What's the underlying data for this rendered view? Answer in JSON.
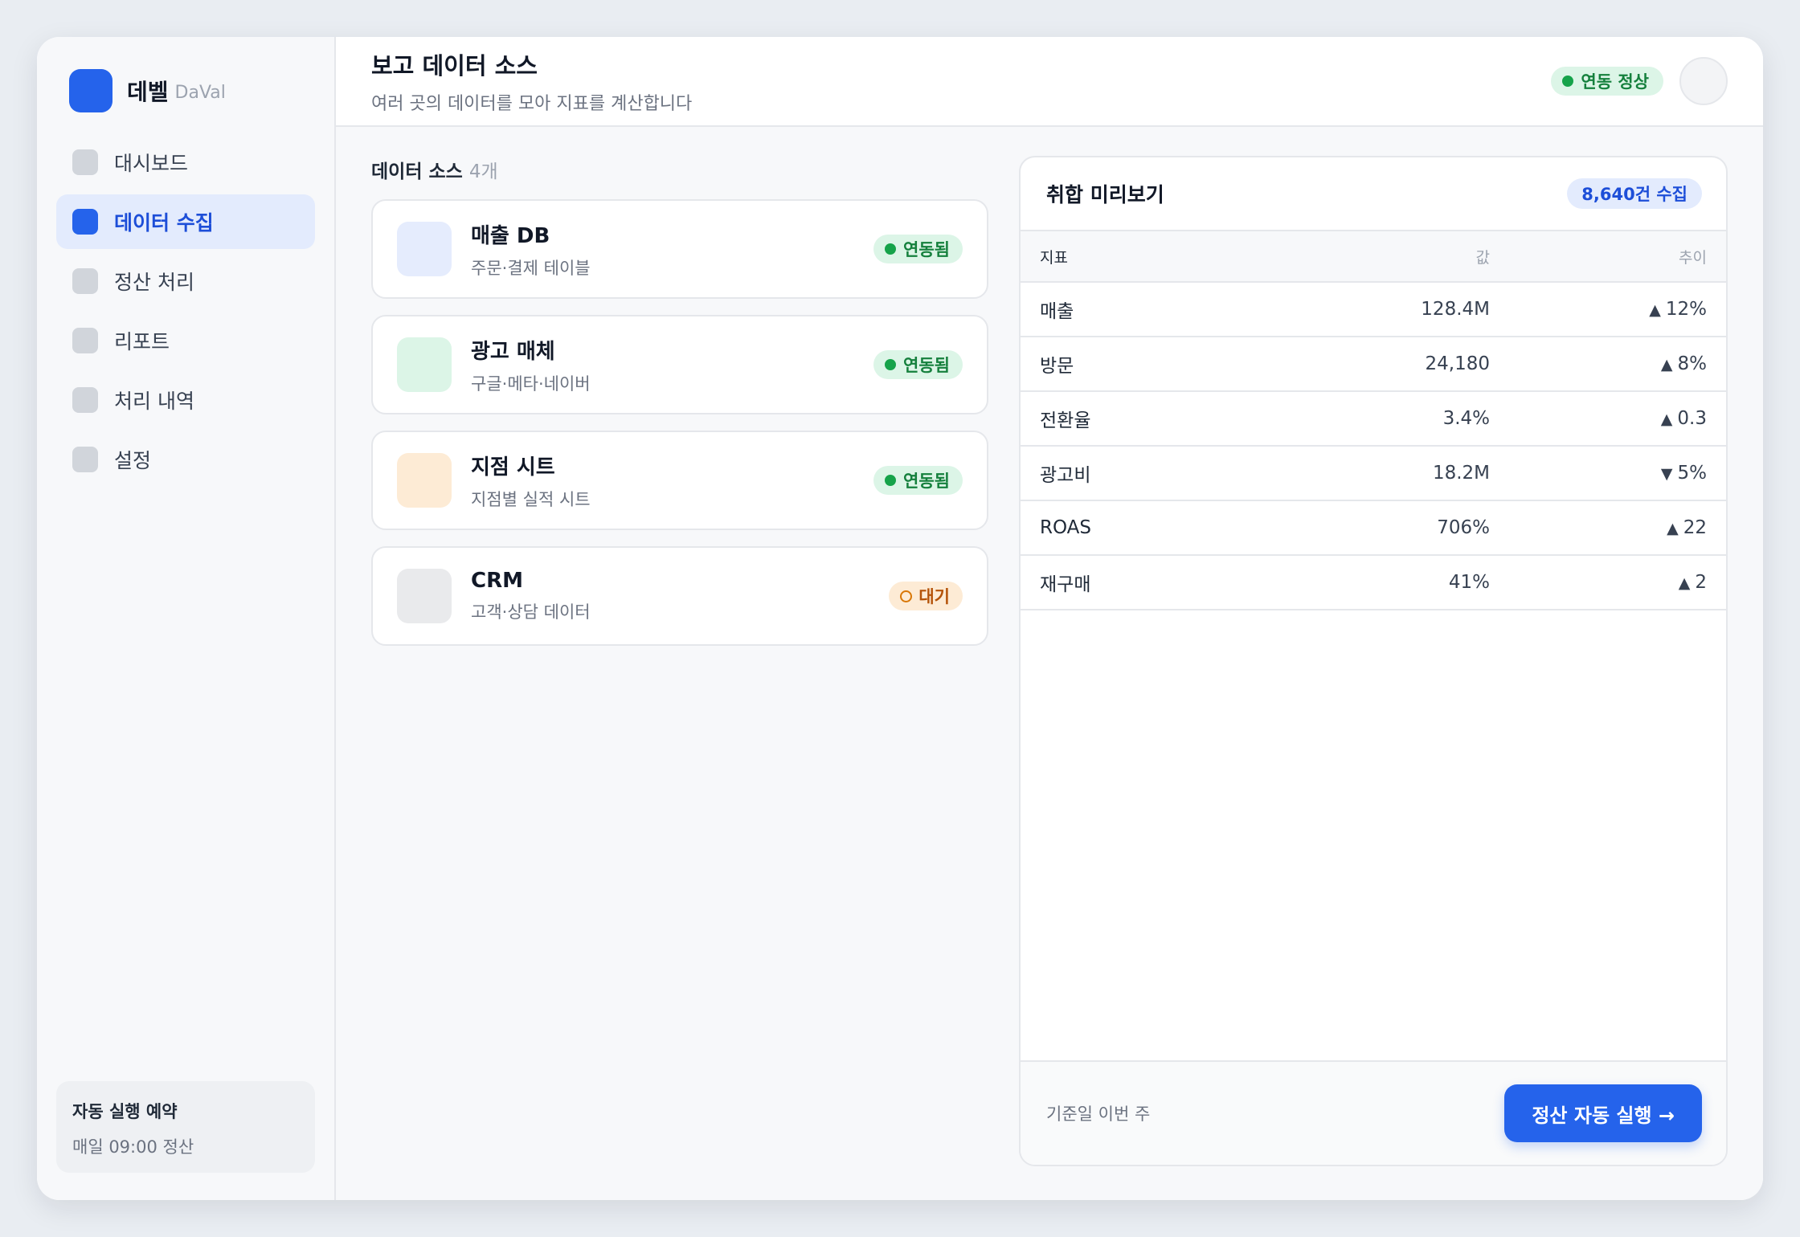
{
  "brand": {
    "name": "데벨",
    "sub": "DaVal",
    "color": "#2563eb"
  },
  "sidebar": {
    "items": [
      {
        "label": "대시보드",
        "active": false
      },
      {
        "label": "데이터 수집",
        "active": true
      },
      {
        "label": "정산 처리",
        "active": false
      },
      {
        "label": "리포트",
        "active": false
      },
      {
        "label": "처리 내역",
        "active": false
      },
      {
        "label": "설정",
        "active": false
      }
    ],
    "schedule": {
      "title": "자동 실행 예약",
      "detail": "매일 09:00 정산"
    }
  },
  "header": {
    "title": "보고 데이터 소스",
    "subtitle": "여러 곳의 데이터를 모아 지표를 계산합니다",
    "status": "연동 정상"
  },
  "sources": {
    "title": "데이터 소스",
    "count": "4개",
    "items": [
      {
        "name": "매출 DB",
        "desc": "주문·결제 테이블",
        "status": "연동됨",
        "icon_color": "#e5ecfd"
      },
      {
        "name": "광고 매체",
        "desc": "구글·메타·네이버",
        "status": "연동됨",
        "icon_color": "#dcf5e7"
      },
      {
        "name": "지점 시트",
        "desc": "지점별 실적 시트",
        "status": "연동됨",
        "icon_color": "#fdebd5"
      },
      {
        "name": "CRM",
        "desc": "고객·상담 데이터",
        "status": "대기",
        "icon_color": "#e9eaec"
      }
    ]
  },
  "preview": {
    "title": "취합 미리보기",
    "count": "8,640건 수집",
    "columns": [
      "지표",
      "값",
      "추이"
    ],
    "rows": [
      {
        "metric": "매출",
        "value": "128.4M",
        "trend_icon": "up-triangle",
        "trend_mark": "▲",
        "trend": "12%"
      },
      {
        "metric": "방문",
        "value": "24,180",
        "trend_icon": "up-triangle",
        "trend_mark": "▲",
        "trend": "8%"
      },
      {
        "metric": "전환율",
        "value": "3.4%",
        "trend_icon": "up-triangle",
        "trend_mark": "▲",
        "trend": "0.3"
      },
      {
        "metric": "광고비",
        "value": "18.2M",
        "trend_icon": "down-triangle",
        "trend_mark": "▼",
        "trend": "5%"
      },
      {
        "metric": "ROAS",
        "value": "706%",
        "trend_icon": "up-triangle",
        "trend_mark": "▲",
        "trend": "22"
      },
      {
        "metric": "재구매",
        "value": "41%",
        "trend_icon": "up-triangle",
        "trend_mark": "▲",
        "trend": "2"
      }
    ],
    "footer_label": "기준일 이번 주",
    "run_button": "정산 자동 실행 →"
  }
}
